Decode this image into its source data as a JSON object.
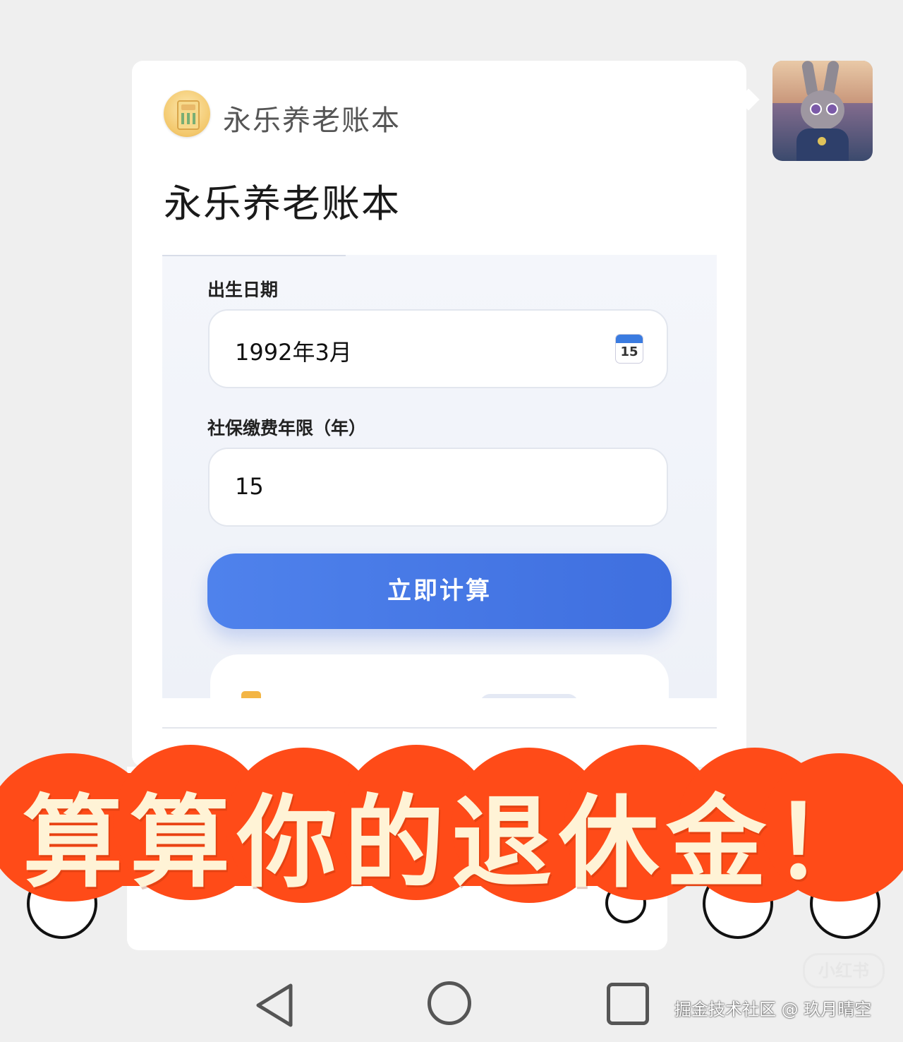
{
  "header": {
    "app_name": "永乐养老账本",
    "page_title": "永乐养老账本"
  },
  "form": {
    "birth_label": "出生日期",
    "birth_value": "1992年3月",
    "calendar_icon": "calendar-icon",
    "calendar_day": "15",
    "years_label": "社保缴费年限（年）",
    "years_value": "15",
    "submit_label": "立即计算"
  },
  "banner": {
    "text": "算算你的退休金！",
    "color": "#ff4b18"
  },
  "watermark": {
    "logo": "小红书",
    "credit": "掘金技术社区 @ 玖月晴空"
  },
  "colors": {
    "accent": "#4f82ec",
    "banner": "#ff4b18"
  }
}
